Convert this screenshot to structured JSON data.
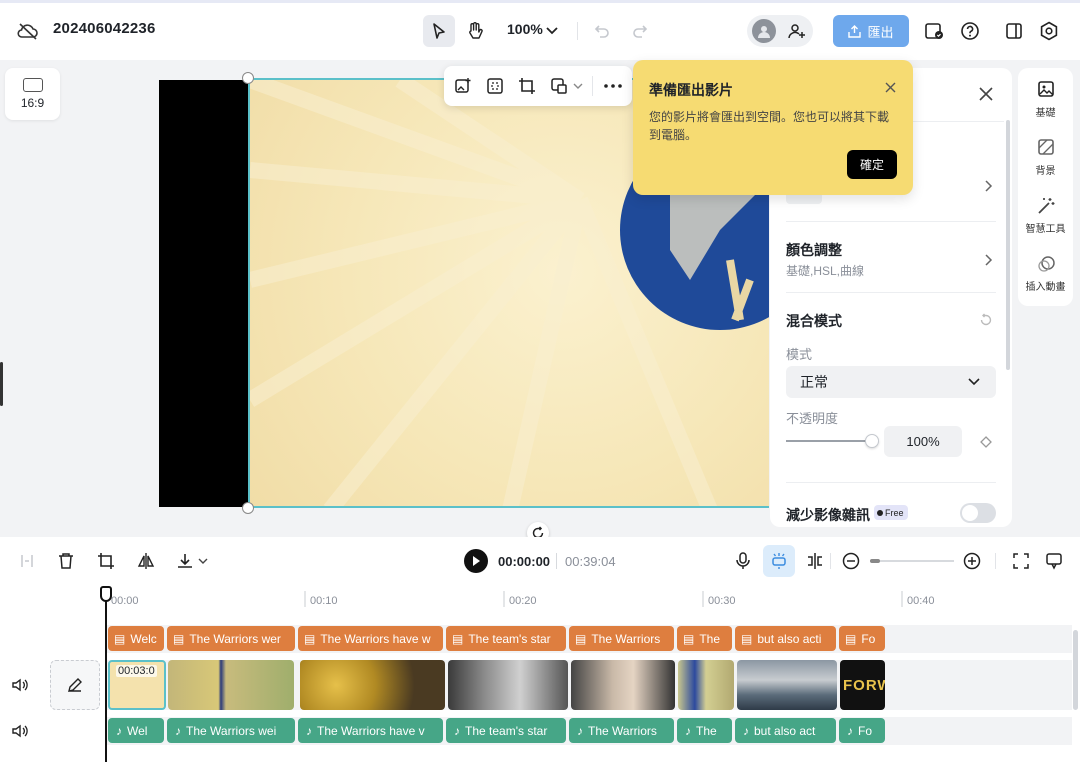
{
  "header": {
    "project_title": "202406042236",
    "zoom": "100%",
    "export_label": "匯出"
  },
  "canvas": {
    "aspect_ratio": "16:9"
  },
  "export_tooltip": {
    "title": "準備匯出影片",
    "body": "您的影片將會匯出到空間。您也可以將其下載到電腦。",
    "confirm": "確定"
  },
  "panel": {
    "color_adjust": {
      "title": "顏色調整",
      "subtitle": "基礎,HSL,曲線"
    },
    "blend": {
      "title": "混合模式",
      "mode_label": "模式",
      "mode_value": "正常",
      "opacity_label": "不透明度",
      "opacity_value": "100%"
    },
    "denoise": {
      "title": "減少影像雜訊",
      "badge": "Free"
    }
  },
  "right_tabs": [
    {
      "label": "基礎",
      "icon": "image-icon"
    },
    {
      "label": "背景",
      "icon": "background-icon"
    },
    {
      "label": "智慧工具",
      "icon": "magic-wand-icon"
    },
    {
      "label": "插入動畫",
      "icon": "animation-icon"
    }
  ],
  "timeline": {
    "current_time": "00:00:00",
    "total_time": "00:39:04",
    "ticks": [
      "00:00",
      "00:10",
      "00:20",
      "00:30",
      "00:40"
    ],
    "first_clip_duration": "00:03:0",
    "captions": [
      "Welc",
      "The Warriors wer",
      "The Warriors have w",
      "The team's star",
      "The Warriors",
      "The",
      "but also acti",
      "Fo"
    ],
    "audio": [
      "Wel",
      "The Warriors wei",
      "The Warriors have v",
      "The team's star",
      "The Warriors",
      "The",
      "but also act",
      "Fo"
    ]
  },
  "colors": {
    "accent": "#6ea8ec",
    "caption": "#de7e3f",
    "audio": "#46a687",
    "tooltip": "#f6db72",
    "selection": "#5bc0c9"
  }
}
